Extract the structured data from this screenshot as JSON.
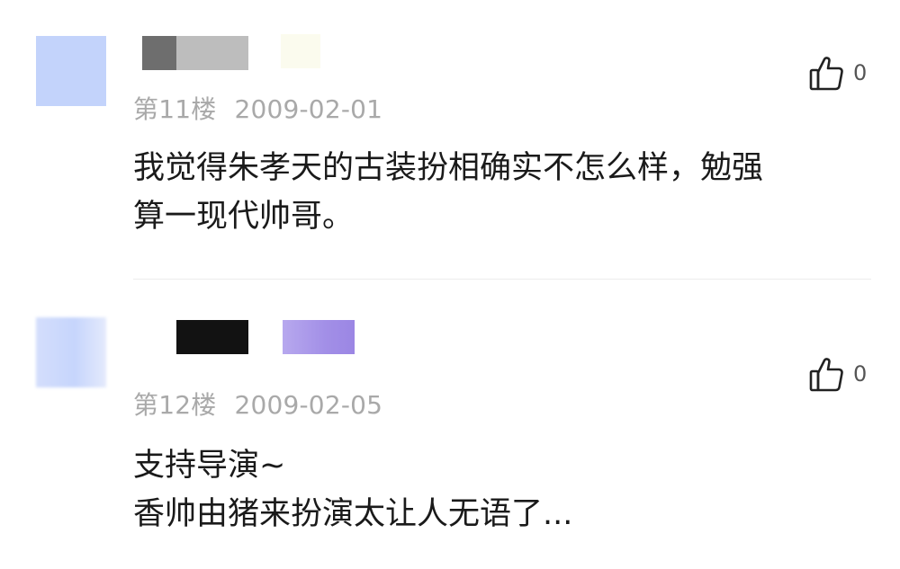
{
  "comments": [
    {
      "floor": "第11楼",
      "date": "2009-02-01",
      "likes": "0",
      "lines": [
        "我觉得朱孝天的古装扮相确实不怎么样，勉强",
        "算一现代帅哥。"
      ]
    },
    {
      "floor": "第12楼",
      "date": "2009-02-05",
      "likes": "0",
      "lines": [
        "支持导演~",
        "香帅由猪来扮演太让人无语了..."
      ]
    }
  ],
  "icons": {
    "like": "thumbs-up-icon"
  }
}
